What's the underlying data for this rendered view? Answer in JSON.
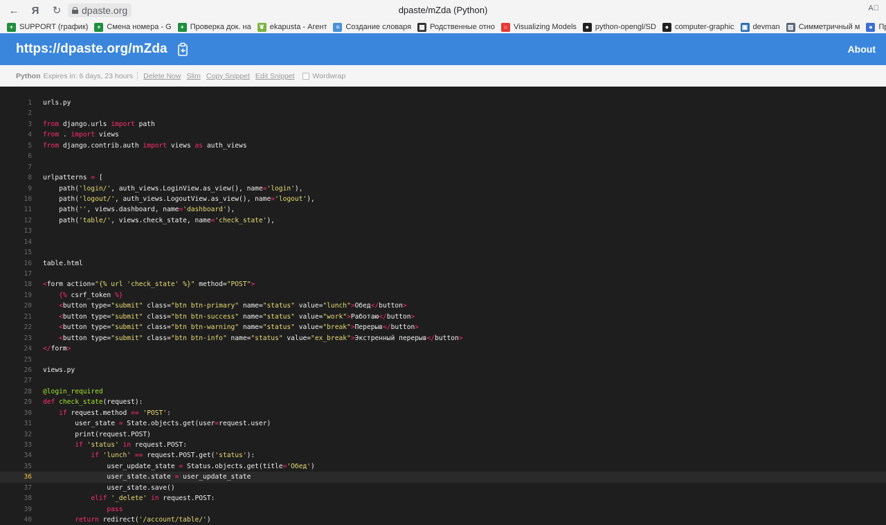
{
  "browser": {
    "back_glyph": "←",
    "yandex_glyph": "Я",
    "reload_glyph": "↻",
    "url": "dpaste.org",
    "window_title": "dpaste/mZda (Python)",
    "top_right": "A⃞",
    "bookmarks": [
      {
        "label": "SUPPORT (график)",
        "icon_color": "#1e8e3e",
        "icon": "plus-icon"
      },
      {
        "label": "Смена номера - G",
        "icon_color": "#1e8e3e",
        "icon": "plus-icon"
      },
      {
        "label": "Проверка док. на",
        "icon_color": "#1e8e3e",
        "icon": "plus-icon"
      },
      {
        "label": "ekapusta - Агент",
        "icon_color": "#7cb342",
        "icon": "leaf-icon"
      },
      {
        "label": "Создание словаря",
        "icon_color": "#4a90d9",
        "icon": "doc-icon"
      },
      {
        "label": "Родственные отно",
        "icon_color": "#333333",
        "icon": "grid-icon"
      },
      {
        "label": "Visualizing Models",
        "icon_color": "#e53935",
        "icon": "circle-icon"
      },
      {
        "label": "python-opengl/SD",
        "icon_color": "#222222",
        "icon": "github-icon"
      },
      {
        "label": "computer-graphic",
        "icon_color": "#222222",
        "icon": "github-icon"
      },
      {
        "label": "devman",
        "icon_color": "#2f6fb5",
        "icon": "chat-icon"
      },
      {
        "label": "Симметричный м",
        "icon_color": "#556677",
        "icon": "image-icon"
      },
      {
        "label": "Прогр",
        "icon_color": "#3b6fd6",
        "icon": "people-icon"
      }
    ]
  },
  "header": {
    "title": "https://dpaste.org/mZda",
    "about": "About"
  },
  "meta": {
    "language": "Python",
    "expires": "Expires in: 6 days, 23 hours",
    "delete": "Delete Now",
    "slim": "Slim",
    "copy": "Copy Snippet",
    "edit": "Edit Snippet",
    "wordwrap": "Wordwrap"
  },
  "colors": {
    "header": "#3b86dd",
    "code_bg": "#1e1e1e",
    "keyword": "#ff2d6f",
    "string": "#e6db74",
    "function": "#a6e22e"
  },
  "highlighted_line": 36,
  "code_lines": [
    {
      "n": "1",
      "t": [
        [
          "",
          "urls.py"
        ]
      ]
    },
    {
      "n": "2",
      "t": []
    },
    {
      "n": "3",
      "t": [
        [
          "kw",
          "from"
        ],
        [
          "",
          " django.urls "
        ],
        [
          "kw",
          "import"
        ],
        [
          "",
          " path"
        ]
      ]
    },
    {
      "n": "4",
      "t": [
        [
          "kw",
          "from"
        ],
        [
          "",
          " . "
        ],
        [
          "kw",
          "import"
        ],
        [
          "",
          " views"
        ]
      ]
    },
    {
      "n": "5",
      "t": [
        [
          "kw",
          "from"
        ],
        [
          "",
          " django.contrib.auth "
        ],
        [
          "kw",
          "import"
        ],
        [
          "",
          " views "
        ],
        [
          "kw",
          "as"
        ],
        [
          "",
          " auth_views"
        ]
      ]
    },
    {
      "n": "6",
      "t": []
    },
    {
      "n": "7",
      "t": []
    },
    {
      "n": "8",
      "t": [
        [
          "",
          "urlpatterns "
        ],
        [
          "op",
          "="
        ],
        [
          "",
          " ["
        ]
      ]
    },
    {
      "n": "9",
      "t": [
        [
          "",
          "    path("
        ],
        [
          "str",
          "'login/'"
        ],
        [
          "",
          ", auth_views.LoginView.as_view(), name"
        ],
        [
          "op",
          "="
        ],
        [
          "str",
          "'login'"
        ],
        [
          "",
          "),"
        ]
      ]
    },
    {
      "n": "10",
      "t": [
        [
          "",
          "    path("
        ],
        [
          "str",
          "'logout/'"
        ],
        [
          "",
          ", auth_views.LogoutView.as_view(), name"
        ],
        [
          "op",
          "="
        ],
        [
          "str",
          "'logout'"
        ],
        [
          "",
          "),"
        ]
      ]
    },
    {
      "n": "11",
      "t": [
        [
          "",
          "    path("
        ],
        [
          "str",
          "''"
        ],
        [
          "",
          ", views.dashboard, name"
        ],
        [
          "op",
          "="
        ],
        [
          "str",
          "'dashboard'"
        ],
        [
          "",
          "),"
        ]
      ]
    },
    {
      "n": "12",
      "t": [
        [
          "",
          "    path("
        ],
        [
          "str",
          "'table/'"
        ],
        [
          "",
          ", views.check_state, name"
        ],
        [
          "op",
          "="
        ],
        [
          "str",
          "'check_state'"
        ],
        [
          "",
          "),"
        ]
      ]
    },
    {
      "n": "13",
      "t": []
    },
    {
      "n": "14",
      "t": []
    },
    {
      "n": "15",
      "t": []
    },
    {
      "n": "16",
      "t": [
        [
          "",
          "table.html"
        ]
      ]
    },
    {
      "n": "17",
      "t": []
    },
    {
      "n": "18",
      "t": [
        [
          "tag",
          "<"
        ],
        [
          "",
          "form action="
        ],
        [
          "str",
          "\"{% url 'check_state' %}\""
        ],
        [
          "",
          " method="
        ],
        [
          "str",
          "\"POST\""
        ],
        [
          "tag",
          ">"
        ]
      ]
    },
    {
      "n": "19",
      "t": [
        [
          "",
          "    "
        ],
        [
          "tag",
          "{%"
        ],
        [
          "",
          " csrf_token "
        ],
        [
          "tag",
          "%}"
        ]
      ]
    },
    {
      "n": "20",
      "t": [
        [
          "",
          "    "
        ],
        [
          "tag",
          "<"
        ],
        [
          "",
          "button type="
        ],
        [
          "str",
          "\"submit\""
        ],
        [
          "",
          " class="
        ],
        [
          "str",
          "\"btn btn-primary\""
        ],
        [
          "",
          " name="
        ],
        [
          "str",
          "\"status\""
        ],
        [
          "",
          " value="
        ],
        [
          "str",
          "\"lunch\""
        ],
        [
          "tag",
          ">"
        ],
        [
          "",
          "Обед"
        ],
        [
          "tag",
          "</"
        ],
        [
          "",
          "button"
        ],
        [
          "tag",
          ">"
        ]
      ]
    },
    {
      "n": "21",
      "t": [
        [
          "",
          "    "
        ],
        [
          "tag",
          "<"
        ],
        [
          "",
          "button type="
        ],
        [
          "str",
          "\"submit\""
        ],
        [
          "",
          " class="
        ],
        [
          "str",
          "\"btn btn-success\""
        ],
        [
          "",
          " name="
        ],
        [
          "str",
          "\"status\""
        ],
        [
          "",
          " value="
        ],
        [
          "str",
          "\"work\""
        ],
        [
          "tag",
          ">"
        ],
        [
          "",
          "Работаю"
        ],
        [
          "tag",
          "</"
        ],
        [
          "",
          "button"
        ],
        [
          "tag",
          ">"
        ]
      ]
    },
    {
      "n": "22",
      "t": [
        [
          "",
          "    "
        ],
        [
          "tag",
          "<"
        ],
        [
          "",
          "button type="
        ],
        [
          "str",
          "\"submit\""
        ],
        [
          "",
          " class="
        ],
        [
          "str",
          "\"btn btn-warning\""
        ],
        [
          "",
          " name="
        ],
        [
          "str",
          "\"status\""
        ],
        [
          "",
          " value="
        ],
        [
          "str",
          "\"break\""
        ],
        [
          "tag",
          ">"
        ],
        [
          "",
          "Перерыв"
        ],
        [
          "tag",
          "</"
        ],
        [
          "",
          "button"
        ],
        [
          "tag",
          ">"
        ]
      ]
    },
    {
      "n": "23",
      "t": [
        [
          "",
          "    "
        ],
        [
          "tag",
          "<"
        ],
        [
          "",
          "button type="
        ],
        [
          "str",
          "\"submit\""
        ],
        [
          "",
          " class="
        ],
        [
          "str",
          "\"btn btn-info\""
        ],
        [
          "",
          " name="
        ],
        [
          "str",
          "\"status\""
        ],
        [
          "",
          " value="
        ],
        [
          "str",
          "\"ex_break\""
        ],
        [
          "tag",
          ">"
        ],
        [
          "",
          "Экстренный перерыв"
        ],
        [
          "tag",
          "</"
        ],
        [
          "",
          "button"
        ],
        [
          "tag",
          ">"
        ]
      ]
    },
    {
      "n": "24",
      "t": [
        [
          "tag",
          "</"
        ],
        [
          "",
          "form"
        ],
        [
          "tag",
          ">"
        ]
      ]
    },
    {
      "n": "25",
      "t": []
    },
    {
      "n": "26",
      "t": [
        [
          "",
          "views.py"
        ]
      ]
    },
    {
      "n": "27",
      "t": []
    },
    {
      "n": "28",
      "t": [
        [
          "fn",
          "@login_required"
        ]
      ]
    },
    {
      "n": "29",
      "t": [
        [
          "kw",
          "def"
        ],
        [
          "",
          " "
        ],
        [
          "fn",
          "check_state"
        ],
        [
          "",
          "(request):"
        ]
      ]
    },
    {
      "n": "30",
      "t": [
        [
          "",
          "    "
        ],
        [
          "kw",
          "if"
        ],
        [
          "",
          " request.method "
        ],
        [
          "op",
          "=="
        ],
        [
          "",
          " "
        ],
        [
          "str",
          "'POST'"
        ],
        [
          "",
          ":"
        ]
      ]
    },
    {
      "n": "31",
      "t": [
        [
          "",
          "        user_state "
        ],
        [
          "op",
          "="
        ],
        [
          "",
          " State.objects.get(user"
        ],
        [
          "op",
          "="
        ],
        [
          "",
          "request.user)"
        ]
      ]
    },
    {
      "n": "32",
      "t": [
        [
          "",
          "        print(request.POST)"
        ]
      ]
    },
    {
      "n": "33",
      "t": [
        [
          "",
          "        "
        ],
        [
          "kw",
          "if"
        ],
        [
          "",
          " "
        ],
        [
          "str",
          "'status'"
        ],
        [
          "",
          " "
        ],
        [
          "kw",
          "in"
        ],
        [
          "",
          " request.POST:"
        ]
      ]
    },
    {
      "n": "34",
      "t": [
        [
          "",
          "            "
        ],
        [
          "kw",
          "if"
        ],
        [
          "",
          " "
        ],
        [
          "str",
          "'lunch'"
        ],
        [
          "",
          " "
        ],
        [
          "op",
          "=="
        ],
        [
          "",
          " request.POST.get("
        ],
        [
          "str",
          "'status'"
        ],
        [
          "",
          "):"
        ]
      ]
    },
    {
      "n": "35",
      "t": [
        [
          "",
          "                user_update_state "
        ],
        [
          "op",
          "="
        ],
        [
          "",
          " Status.objects.get(title"
        ],
        [
          "op",
          "="
        ],
        [
          "str",
          "'Обед'"
        ],
        [
          "",
          ")"
        ]
      ]
    },
    {
      "n": "36",
      "t": [
        [
          "",
          "                user_state.state "
        ],
        [
          "op",
          "="
        ],
        [
          "",
          " user_update_state"
        ]
      ]
    },
    {
      "n": "37",
      "t": [
        [
          "",
          "                user_state.save()"
        ]
      ]
    },
    {
      "n": "38",
      "t": [
        [
          "",
          "            "
        ],
        [
          "kw",
          "elif"
        ],
        [
          "",
          " "
        ],
        [
          "str",
          "'_delete'"
        ],
        [
          "",
          " "
        ],
        [
          "kw",
          "in"
        ],
        [
          "",
          " request.POST:"
        ]
      ]
    },
    {
      "n": "39",
      "t": [
        [
          "",
          "                "
        ],
        [
          "kw",
          "pass"
        ]
      ]
    },
    {
      "n": "40",
      "t": [
        [
          "",
          "        "
        ],
        [
          "kw",
          "return"
        ],
        [
          "",
          " redirect("
        ],
        [
          "str",
          "'/account/table/'"
        ],
        [
          "",
          ")"
        ]
      ]
    }
  ]
}
